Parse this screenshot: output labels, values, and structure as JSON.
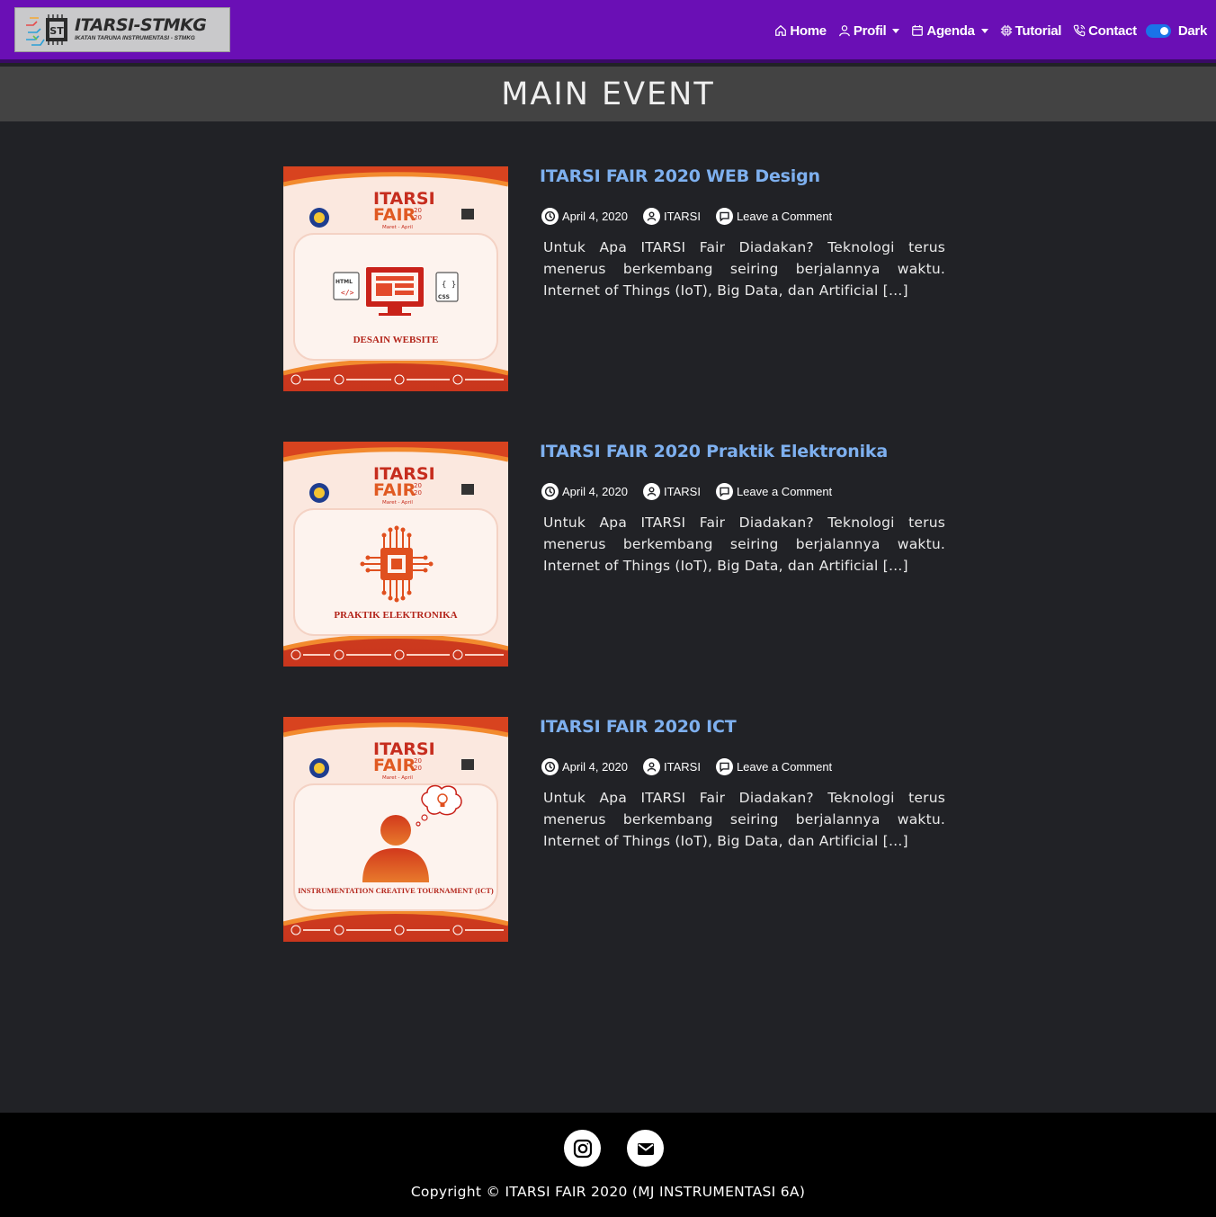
{
  "brand": {
    "title": "ITARSI-STMKG",
    "subtitle": "IKATAN TARUNA INSTRUMENTASI - STMKG"
  },
  "nav": {
    "items": [
      {
        "label": "Home",
        "icon": "home-icon"
      },
      {
        "label": "Profil",
        "icon": "user-icon",
        "dropdown": true
      },
      {
        "label": "Agenda",
        "icon": "calendar-icon",
        "dropdown": true
      },
      {
        "label": "Tutorial",
        "icon": "cpu-icon"
      },
      {
        "label": "Contact",
        "icon": "phone-icon"
      }
    ],
    "theme_toggle_label": "Dark",
    "theme_toggle_on": true
  },
  "page": {
    "title": "MAIN EVENT"
  },
  "posts": [
    {
      "title": "ITARSI FAIR 2020 WEB Design",
      "date": "April 4, 2020",
      "author": "ITARSI",
      "comments": "Leave a Comment",
      "excerpt": "Untuk Apa ITARSI Fair Diadakan? Teknologi terus menerus berkembang seiring berjalannya waktu. Internet of Things (IoT), Big Data, dan Artificial […]",
      "thumb": {
        "itarsi": "ITARSI",
        "fair": "FAIR",
        "year_top": "20",
        "year_bottom": "20",
        "period": "Maret - April",
        "caption": "DESAIN WEBSITE",
        "html_tag": "HTML",
        "css_tag": "CSS"
      }
    },
    {
      "title": "ITARSI FAIR 2020 Praktik Elektronika",
      "date": "April 4, 2020",
      "author": "ITARSI",
      "comments": "Leave a Comment",
      "excerpt": "Untuk Apa ITARSI Fair Diadakan? Teknologi terus menerus berkembang seiring berjalannya waktu. Internet of Things (IoT), Big Data, dan Artificial […]",
      "thumb": {
        "itarsi": "ITARSI",
        "fair": "FAIR",
        "year_top": "20",
        "year_bottom": "20",
        "period": "Maret - April",
        "caption": "PRAKTIK ELEKTRONIKA"
      }
    },
    {
      "title": "ITARSI FAIR 2020 ICT",
      "date": "April 4, 2020",
      "author": "ITARSI",
      "comments": "Leave a Comment",
      "excerpt": "Untuk Apa ITARSI Fair Diadakan? Teknologi terus menerus berkembang seiring berjalannya waktu. Internet of Things (IoT), Big Data, dan Artificial […]",
      "thumb": {
        "itarsi": "ITARSI",
        "fair": "FAIR",
        "year_top": "20",
        "year_bottom": "20",
        "period": "Maret - April",
        "caption": "INSTRUMENTATION CREATIVE TOURNAMENT (ICT)"
      }
    }
  ],
  "footer": {
    "social": [
      {
        "icon": "instagram-icon"
      },
      {
        "icon": "mail-icon"
      }
    ],
    "copyright": "Copyright © ITARSI FAIR 2020 (MJ INSTRUMENTASI 6A)"
  },
  "colors": {
    "navbar": "#6a0fb5",
    "band": "#434343",
    "background": "#212226",
    "post_title": "#7eb0ef",
    "toggle": "#1a73e8",
    "footer": "#000000"
  }
}
